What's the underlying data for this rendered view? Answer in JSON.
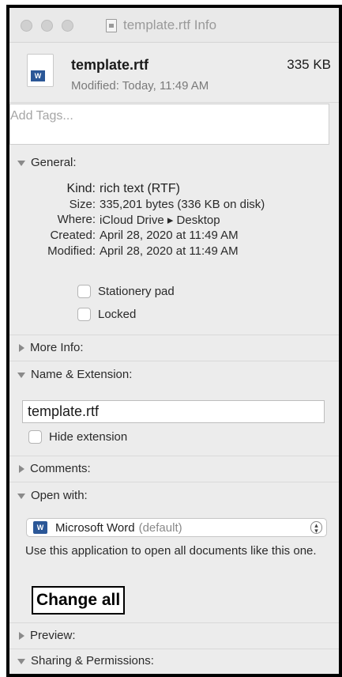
{
  "window": {
    "title": "template.rtf Info"
  },
  "file": {
    "name": "template.rtf",
    "size": "335 KB",
    "modified": "Modified: Today, 11:49 AM",
    "icon_badge": "W"
  },
  "tags": {
    "placeholder": "Add Tags..."
  },
  "general": {
    "header": "General:",
    "rows": [
      {
        "label": "Kind:",
        "value": "rich text (RTF)"
      },
      {
        "label": "Size:",
        "value": "335,201 bytes (336 KB on disk)"
      },
      {
        "label": "Where:",
        "value": "iCloud Drive ▸ Desktop"
      },
      {
        "label": "Created:",
        "value": "April 28, 2020 at 11:49 AM"
      },
      {
        "label": "Modified:",
        "value": "April 28, 2020 at 11:49 AM"
      }
    ],
    "stationery_label": "Stationery pad",
    "locked_label": "Locked"
  },
  "more_info": {
    "header": "More Info:"
  },
  "name_extension": {
    "header": "Name & Extension:",
    "value": "template.rtf",
    "hide_extension_label": "Hide extension"
  },
  "comments": {
    "header": "Comments:"
  },
  "open_with": {
    "header": "Open with:",
    "app_name": "Microsoft Word",
    "app_default": "(default)",
    "help": "Use this application to open all documents like this one.",
    "change_all_label": "Change all"
  },
  "preview": {
    "header": "Preview:"
  },
  "sharing": {
    "header": "Sharing & Permissions:"
  },
  "colors": {
    "word_blue": "#2b5797",
    "window_bg": "#ececec"
  }
}
